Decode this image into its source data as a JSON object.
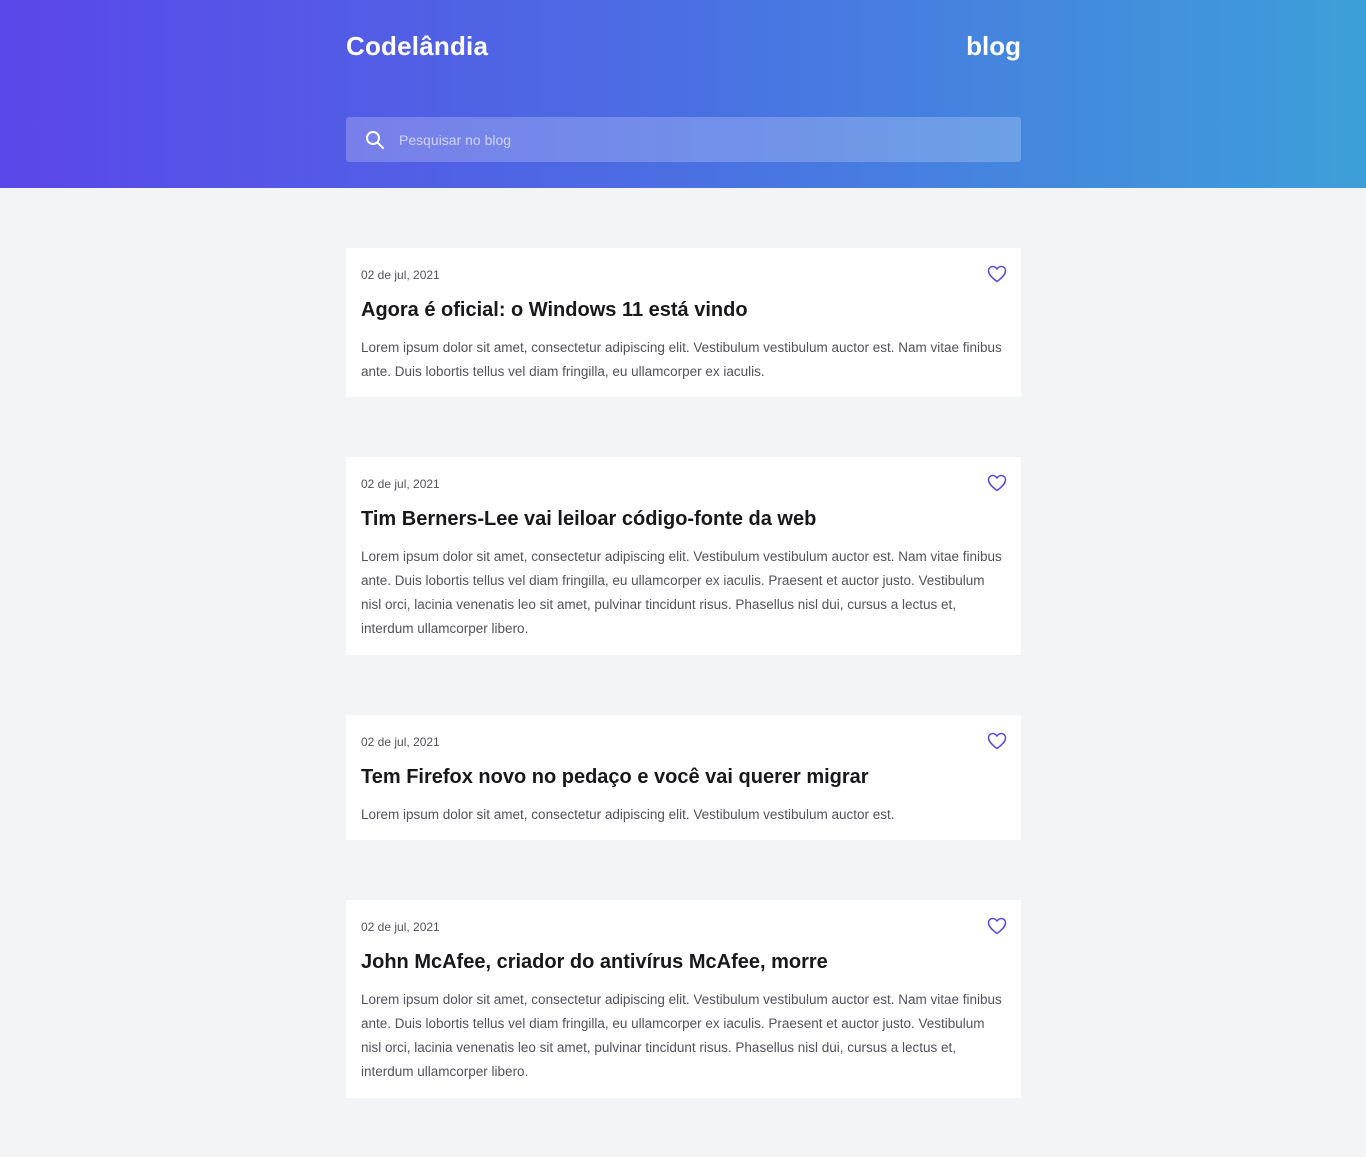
{
  "header": {
    "brand": "Codelândia",
    "section": "blog",
    "search_placeholder": "Pesquisar no blog",
    "gradient_start": "#5a47e9",
    "gradient_end": "#3d9fd9"
  },
  "icons": {
    "search": "search-icon",
    "favorite": "heart-icon"
  },
  "accent_color": "#5a47e9",
  "posts": [
    {
      "date": "02 de jul, 2021",
      "title": "Agora é oficial: o Windows 11 está vindo",
      "body": "Lorem ipsum dolor sit amet, consectetur adipiscing elit. Vestibulum vestibulum auctor est. Nam vitae finibus ante. Duis lobortis tellus vel diam fringilla, eu ullamcorper ex iaculis."
    },
    {
      "date": "02 de jul, 2021",
      "title": "Tim Berners-Lee vai leiloar código-fonte da web",
      "body": "Lorem ipsum dolor sit amet, consectetur adipiscing elit. Vestibulum vestibulum auctor est. Nam vitae finibus ante. Duis lobortis tellus vel diam fringilla, eu ullamcorper ex iaculis. Praesent et auctor justo. Vestibulum nisl orci, lacinia venenatis leo sit amet, pulvinar tincidunt risus. Phasellus nisl dui, cursus a lectus et, interdum ullamcorper libero."
    },
    {
      "date": "02 de jul, 2021",
      "title": "Tem Firefox novo no pedaço e você vai querer migrar",
      "body": "Lorem ipsum dolor sit amet, consectetur adipiscing elit. Vestibulum vestibulum auctor est."
    },
    {
      "date": "02 de jul, 2021",
      "title": "John McAfee, criador do antivírus McAfee, morre",
      "body": "Lorem ipsum dolor sit amet, consectetur adipiscing elit. Vestibulum vestibulum auctor est. Nam vitae finibus ante. Duis lobortis tellus vel diam fringilla, eu ullamcorper ex iaculis. Praesent et auctor justo. Vestibulum nisl orci, lacinia venenatis leo sit amet, pulvinar tincidunt risus. Phasellus nisl dui, cursus a lectus et, interdum ullamcorper libero."
    }
  ]
}
